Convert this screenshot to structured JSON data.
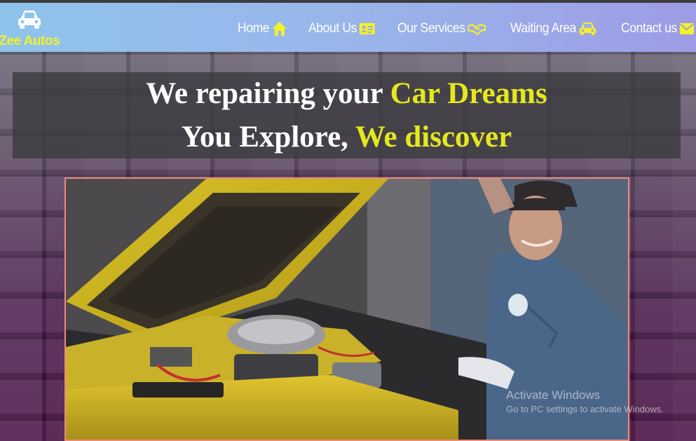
{
  "brand": {
    "name": "mZee Autos",
    "logo_icon": "car-icon"
  },
  "nav": {
    "items": [
      {
        "label": "Home",
        "icon": "home-icon"
      },
      {
        "label": "About Us",
        "icon": "id-card-icon"
      },
      {
        "label": "Our Services",
        "icon": "handshake-icon"
      },
      {
        "label": "Waiting Area",
        "icon": "car-icon"
      },
      {
        "label": "Contact us",
        "icon": "envelope-icon"
      }
    ]
  },
  "headline": {
    "line1_prefix": "We repairing your ",
    "line1_highlight": "Car Dreams",
    "line2_prefix": "You Explore, ",
    "line2_highlight": "We discover"
  },
  "hero": {
    "image": "mechanic-working-on-yellow-car-engine"
  },
  "watermark": {
    "title": "Activate Windows",
    "subtitle": "Go to PC settings to activate Windows."
  },
  "colors": {
    "accent": "#e4e81d",
    "navbar_start": "#8ec4ec",
    "navbar_end": "#9d9ce6",
    "hero_border": "#f08a7a"
  }
}
